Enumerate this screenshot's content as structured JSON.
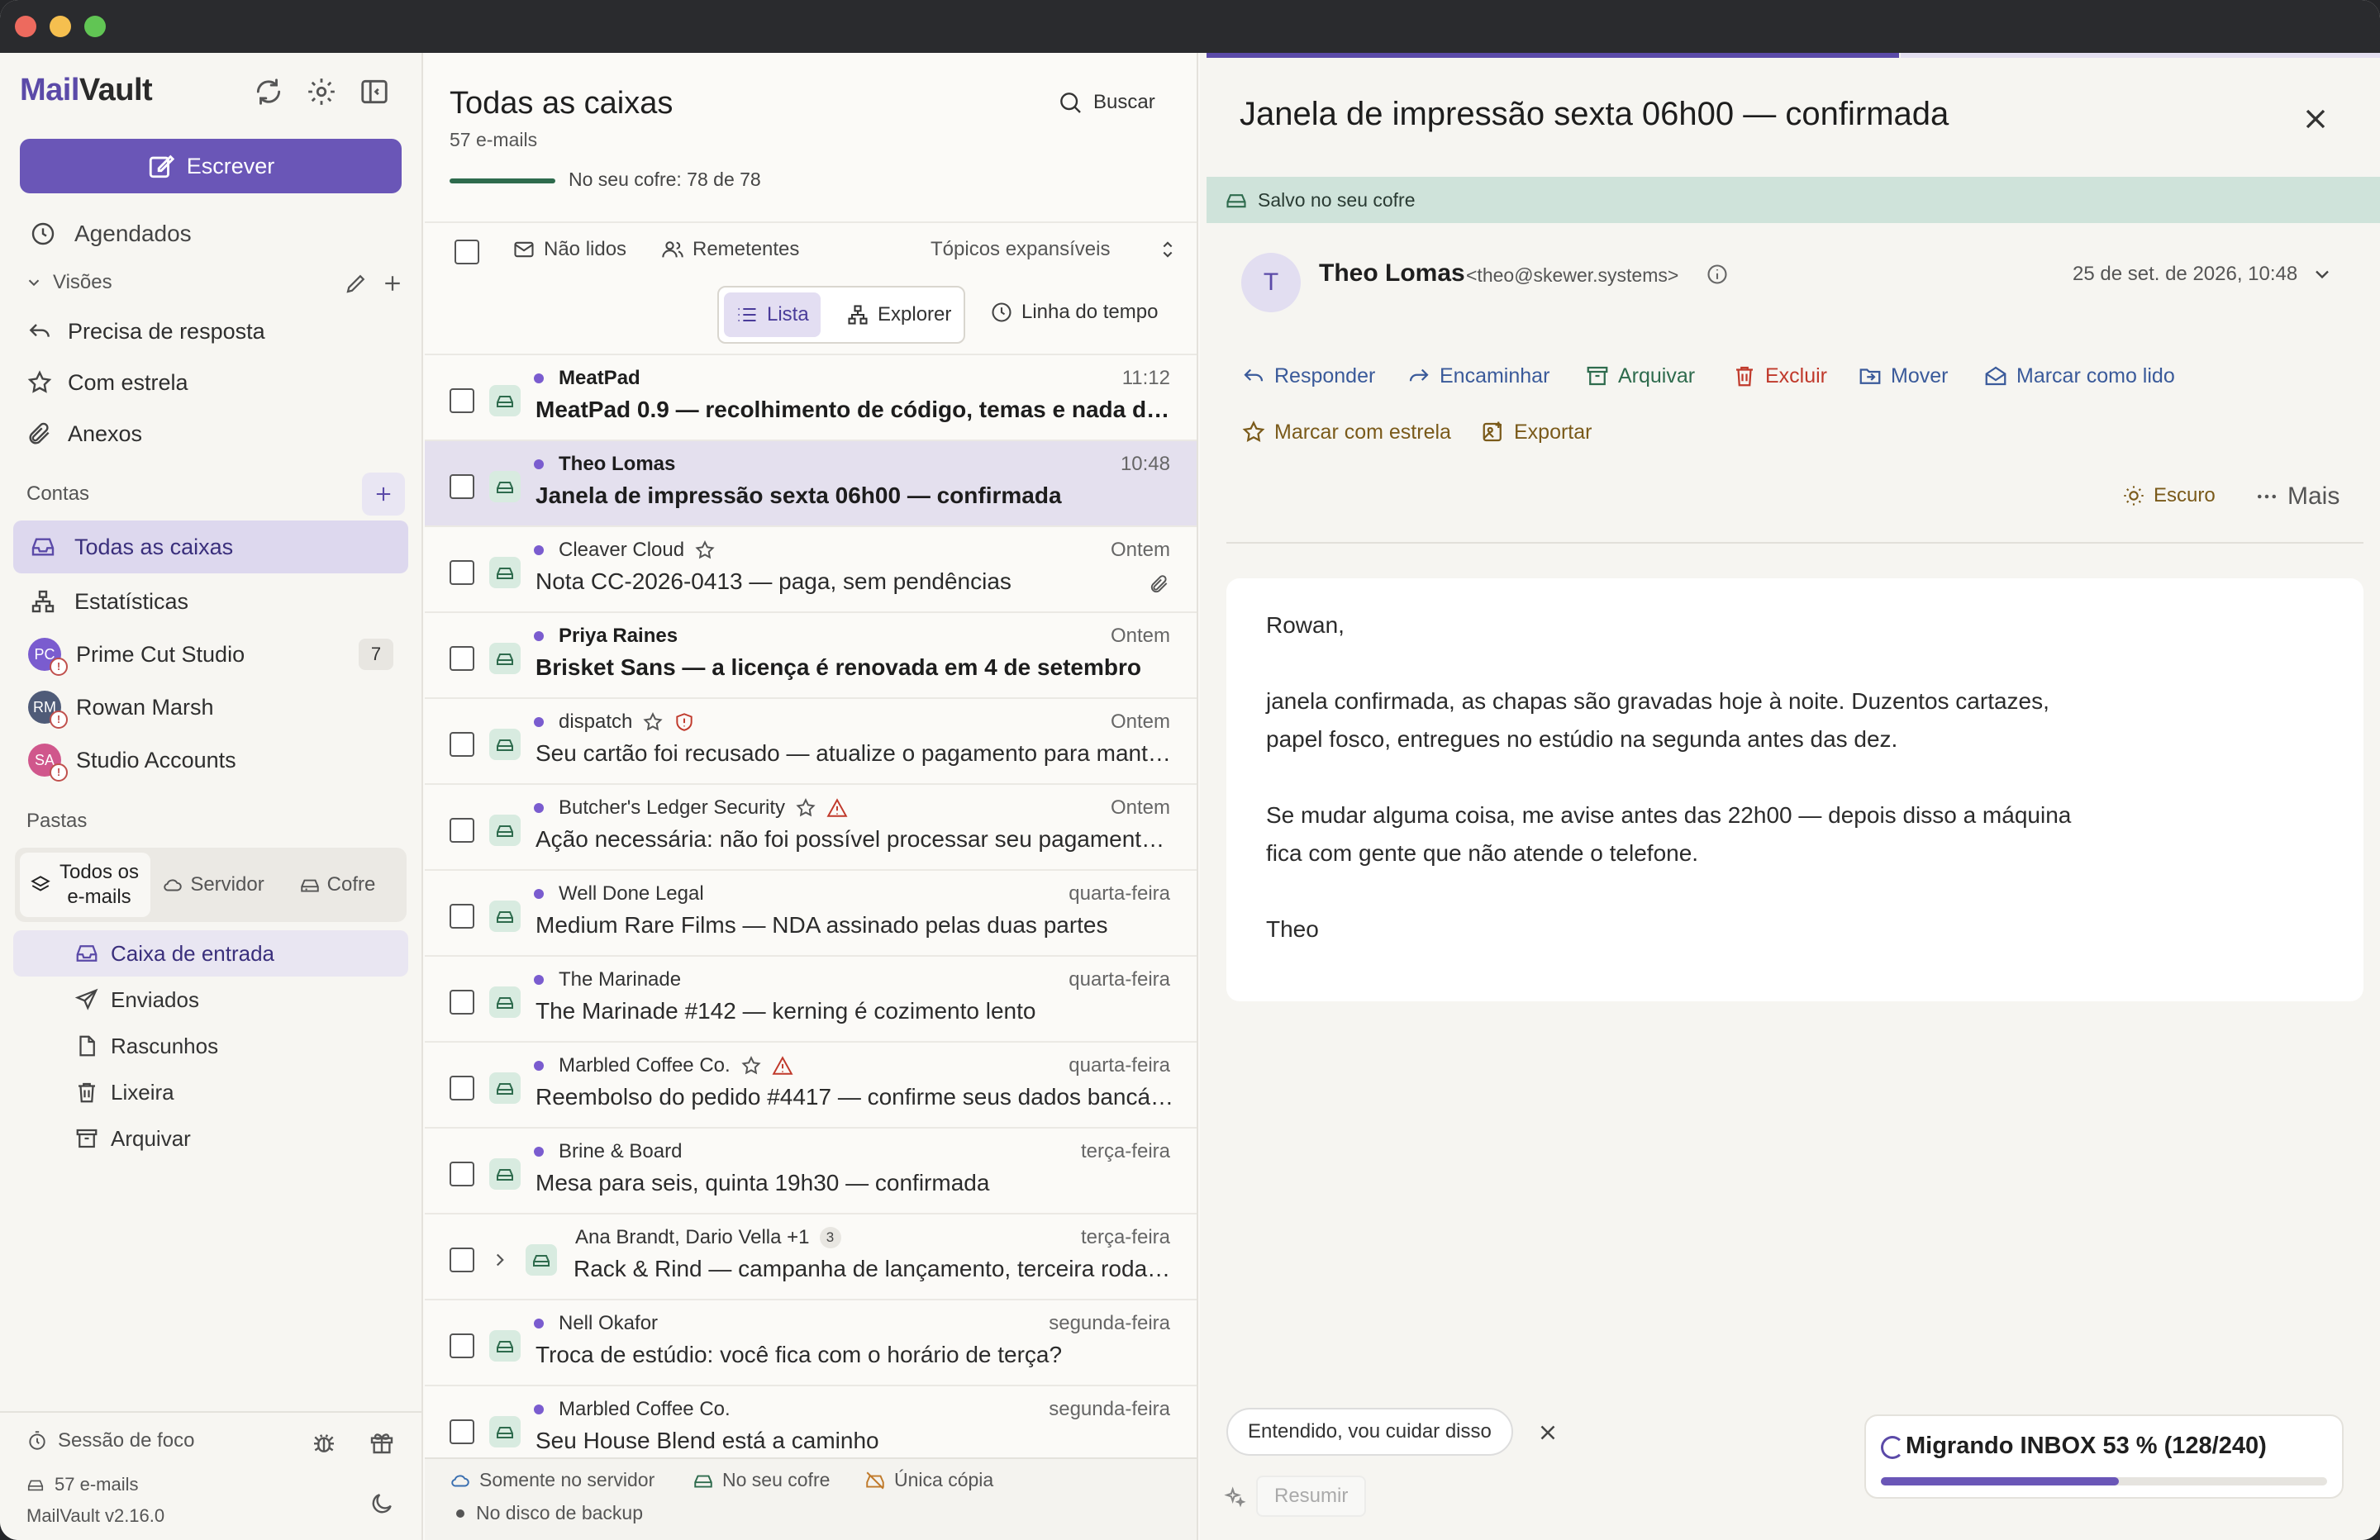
{
  "colors": {
    "accent": "#6a56b7",
    "vault_green": "#2e6b4d",
    "danger": "#c0392b",
    "unread_dot": "#7a5ccf",
    "action_blue": "#3a5a9a",
    "action_brown": "#7a5a1a"
  },
  "app": {
    "logo_part1": "Mail",
    "logo_part2": "Vault",
    "version": "MailVault v2.16.0"
  },
  "sidebar": {
    "compose_label": "Escrever",
    "scheduled": "Agendados",
    "views_label": "Visões",
    "views": [
      {
        "label": "Precisa de resposta",
        "icon": "reply-icon"
      },
      {
        "label": "Com estrela",
        "icon": "star-icon"
      },
      {
        "label": "Anexos",
        "icon": "paperclip-icon"
      }
    ],
    "accounts_label": "Contas",
    "all_inboxes": "Todas as caixas",
    "stats": "Estatísticas",
    "accounts": [
      {
        "name": "Prime Cut Studio",
        "initials": "PC",
        "color": "#7a5ccf",
        "badge": "7",
        "warn": "!"
      },
      {
        "name": "Rowan Marsh",
        "initials": "RM",
        "color": "#4f5b78",
        "badge": "",
        "warn": "!"
      },
      {
        "name": "Studio Accounts",
        "initials": "SA",
        "color": "#d0578c",
        "badge": "",
        "warn": "!"
      }
    ],
    "folders_label": "Pastas",
    "folder_tabs": [
      "Todos os e-mails",
      "Servidor",
      "Cofre"
    ],
    "folders": [
      {
        "label": "Caixa de entrada",
        "icon": "inbox-icon"
      },
      {
        "label": "Enviados",
        "icon": "send-icon"
      },
      {
        "label": "Rascunhos",
        "icon": "draft-icon"
      },
      {
        "label": "Lixeira",
        "icon": "trash-icon"
      },
      {
        "label": "Arquivar",
        "icon": "archive-icon"
      }
    ],
    "focus_session": "Sessão de foco",
    "email_count": "57 e-mails"
  },
  "list": {
    "title": "Todas as caixas",
    "count": "57 e-mails",
    "vault_progress_text": "No seu cofre: 78 de 78",
    "vault_progress": 1.0,
    "search": "Buscar",
    "filter_unread": "Não lidos",
    "filter_senders": "Remetentes",
    "filter_topics": "Tópicos expansíveis",
    "view_list": "Lista",
    "view_explorer": "Explorer",
    "view_timeline": "Linha do tempo",
    "rows": [
      {
        "from": "MeatPad",
        "time": "11:12",
        "subject": "MeatPad 0.9 — recolhimento de código, temas e nada de …",
        "unread": true,
        "selected": false,
        "flag": ""
      },
      {
        "from": "Theo Lomas",
        "time": "10:48",
        "subject": "Janela de impressão sexta 06h00 — confirmada",
        "unread": true,
        "selected": true,
        "flag": ""
      },
      {
        "from": "Cleaver Cloud",
        "time": "Ontem",
        "subject": "Nota CC-2026-0413 — paga, sem pendências",
        "unread": false,
        "selected": false,
        "flag": "star",
        "attach": true
      },
      {
        "from": "Priya Raines",
        "time": "Ontem",
        "subject": "Brisket Sans — a licença é renovada em 4 de setembro",
        "unread": true,
        "selected": false,
        "flag": ""
      },
      {
        "from": "dispatch",
        "time": "Ontem",
        "subject": "Seu cartão foi recusado — atualize o pagamento para mant…",
        "unread": false,
        "selected": false,
        "flag": "star-shield"
      },
      {
        "from": "Butcher's Ledger Security",
        "time": "Ontem",
        "subject": "Ação necessária: não foi possível processar seu pagament…",
        "unread": false,
        "selected": false,
        "flag": "star-warn"
      },
      {
        "from": "Well Done Legal",
        "time": "quarta-feira",
        "subject": "Medium Rare Films — NDA assinado pelas duas partes",
        "unread": false,
        "selected": false,
        "flag": ""
      },
      {
        "from": "The Marinade",
        "time": "quarta-feira",
        "subject": "The Marinade #142 — kerning é cozimento lento",
        "unread": false,
        "selected": false,
        "flag": ""
      },
      {
        "from": "Marbled Coffee Co.",
        "time": "quarta-feira",
        "subject": "Reembolso do pedido #4417 — confirme seus dados bancá…",
        "unread": false,
        "selected": false,
        "flag": "star-warn"
      },
      {
        "from": "Brine & Board",
        "time": "terça-feira",
        "subject": "Mesa para seis, quinta 19h30 — confirmada",
        "unread": false,
        "selected": false,
        "flag": ""
      },
      {
        "from": "Ana Brandt, Dario Vella +1",
        "time": "terça-feira",
        "subject": "Rack & Rind — campanha de lançamento, terceira roda…",
        "unread": false,
        "selected": false,
        "flag": "thread",
        "thread_count": "3"
      },
      {
        "from": "Nell Okafor",
        "time": "segunda-feira",
        "subject": "Troca de estúdio: você fica com o horário de terça?",
        "unread": false,
        "selected": false,
        "flag": ""
      },
      {
        "from": "Marbled Coffee Co.",
        "time": "segunda-feira",
        "subject": "Seu House Blend está a caminho",
        "unread": false,
        "selected": false,
        "flag": ""
      }
    ],
    "legend": {
      "server_only": "Somente no servidor",
      "in_vault": "No seu cofre",
      "single_copy": "Única cópia",
      "backup_disk": "No disco de backup"
    }
  },
  "reader": {
    "title": "Janela de impressão sexta 06h00 — confirmada",
    "saved_banner": "Salvo no seu cofre",
    "avatar_initial": "T",
    "sender_name": "Theo Lomas",
    "sender_email": "<theo@skewer.systems>",
    "date": "25 de set. de 2026, 10:48",
    "actions": {
      "reply": "Responder",
      "forward": "Encaminhar",
      "archive": "Arquivar",
      "delete": "Excluir",
      "move": "Mover",
      "mark_read": "Marcar como lido",
      "star": "Marcar com estrela",
      "export": "Exportar",
      "dark": "Escuro",
      "more": "Mais"
    },
    "body": [
      "Rowan,",
      "janela confirmada, as chapas são gravadas hoje à noite. Duzentos cartazes,",
      "papel fosco, entregues no estúdio na segunda antes das dez.",
      "Se mudar alguma coisa, me avise antes das 22h00 — depois disso a máquina",
      "fica com gente que não atende o telefone.",
      "Theo"
    ],
    "quick_reply": "Entendido, vou cuidar disso",
    "summarize": "Resumir",
    "reading_progress": 0.59,
    "migration_text": "Migrando INBOX 53 % (128/240)",
    "migration_progress": 0.533
  }
}
